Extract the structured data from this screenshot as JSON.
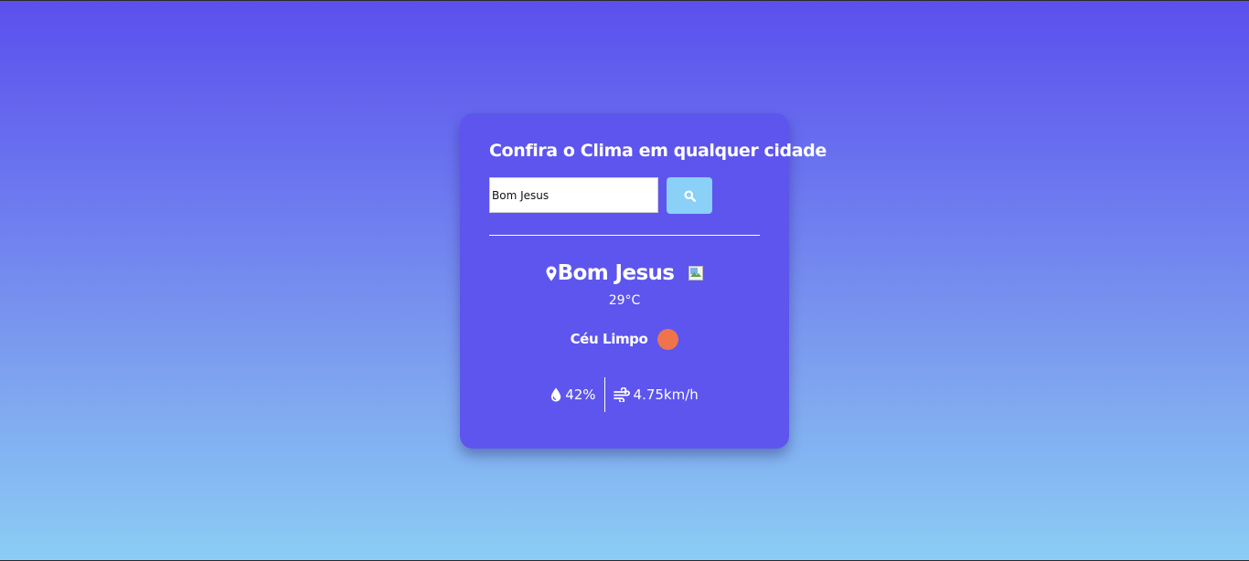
{
  "card": {
    "title": "Confira o Clima em qualquer cidade"
  },
  "search": {
    "value": "Bom Jesus",
    "button_icon": "search-icon"
  },
  "weather": {
    "city": "Bom Jesus",
    "location_icon": "map-pin-icon",
    "temperature": "29",
    "temperature_unit": "°C",
    "description": "Céu Limpo",
    "description_icon": "clear-sky-icon",
    "humidity": "42%",
    "humidity_icon": "water-drop-icon",
    "wind": "4.75km/h",
    "wind_icon": "wind-icon"
  },
  "colors": {
    "card_bg": "#5d55ee",
    "button_bg": "#8ad0f7",
    "weather_icon": "#ef744d",
    "gradient_top": "#5b4fee",
    "gradient_bottom": "#8bcdf5"
  }
}
